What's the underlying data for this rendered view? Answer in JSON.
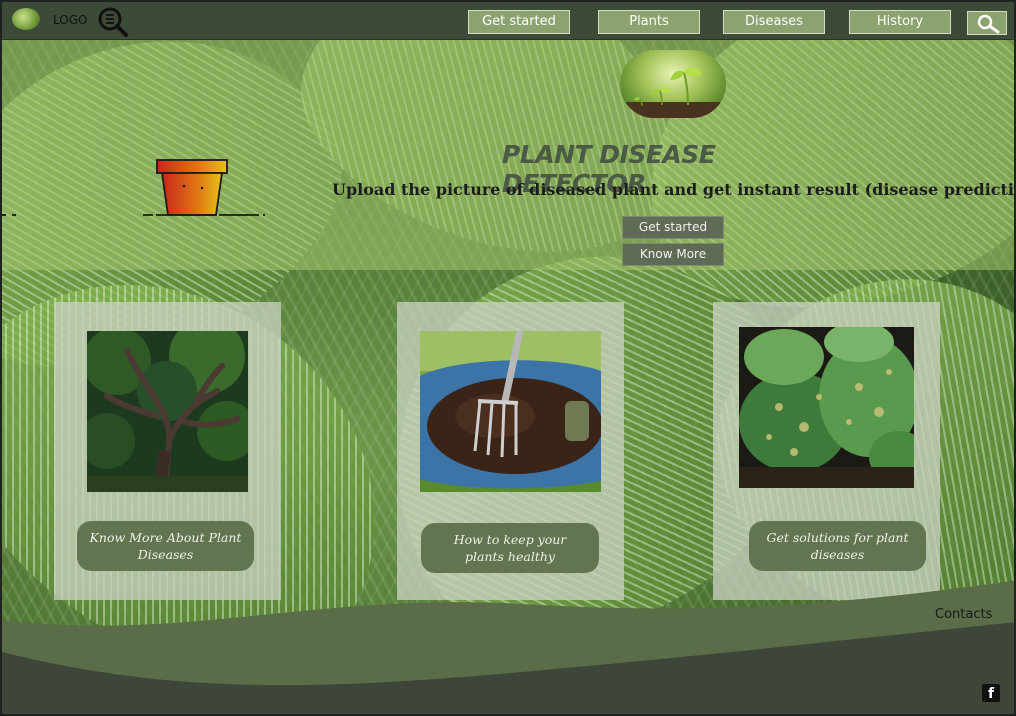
{
  "nav": {
    "logo_text": "LOGO",
    "buttons": [
      "Get started",
      "Plants",
      "Diseases",
      "History"
    ],
    "search_icon": "search-icon"
  },
  "hero": {
    "title": "PLANT DISEASE DETECTOR",
    "subtitle": "Upload the picture of diseased plant and get instant result (disease prediction)",
    "get_started": "Get started",
    "know_more": "Know More"
  },
  "cards": [
    {
      "label": "Know More About Plant Diseases",
      "image": "tree-photo"
    },
    {
      "label": "How to keep your plants healthy",
      "image": "wheelbarrow-soil-photo"
    },
    {
      "label": "Get solutions for plant diseases",
      "image": "diseased-leaves-photo"
    }
  ],
  "footer": {
    "contacts": "Contacts",
    "facebook_icon": "facebook-icon"
  },
  "colors": {
    "nav_bg": "#3c4a37",
    "nav_button": "#8da36f",
    "hero_button": "#5f6b55",
    "card_button": "#627450",
    "footer_dark": "#3d4639",
    "footer_mid": "#5a6c48"
  }
}
